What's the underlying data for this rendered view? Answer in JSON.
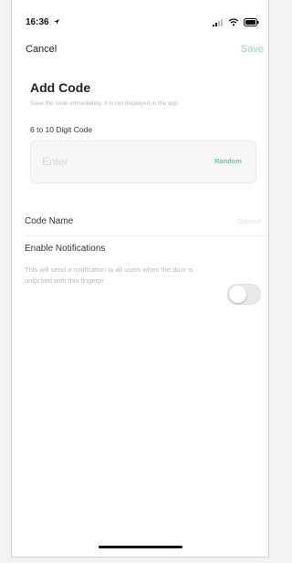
{
  "status_bar": {
    "time": "16:36",
    "icons": [
      "location-arrow-icon",
      "signal-icon",
      "wifi-icon",
      "battery-icon"
    ]
  },
  "nav": {
    "cancel_label": "Cancel",
    "save_label": "Save"
  },
  "page": {
    "title": "Add Code",
    "subtitle": "Save the code immediately. It is not displayed in the app."
  },
  "code_field": {
    "label": "6 to 10 Digit Code",
    "placeholder": "Enter",
    "random_label": "Random"
  },
  "code_name": {
    "label": "Code Name",
    "placeholder": "Optional"
  },
  "notifications": {
    "label": "Enable Notifications",
    "description": "This will send a notification to all users when the door is unlocked with this fingerpr",
    "enabled": false
  },
  "colors": {
    "accent": "#8fd1b5",
    "random_text": "#74c49f",
    "muted_text": "#b7b7b7"
  }
}
